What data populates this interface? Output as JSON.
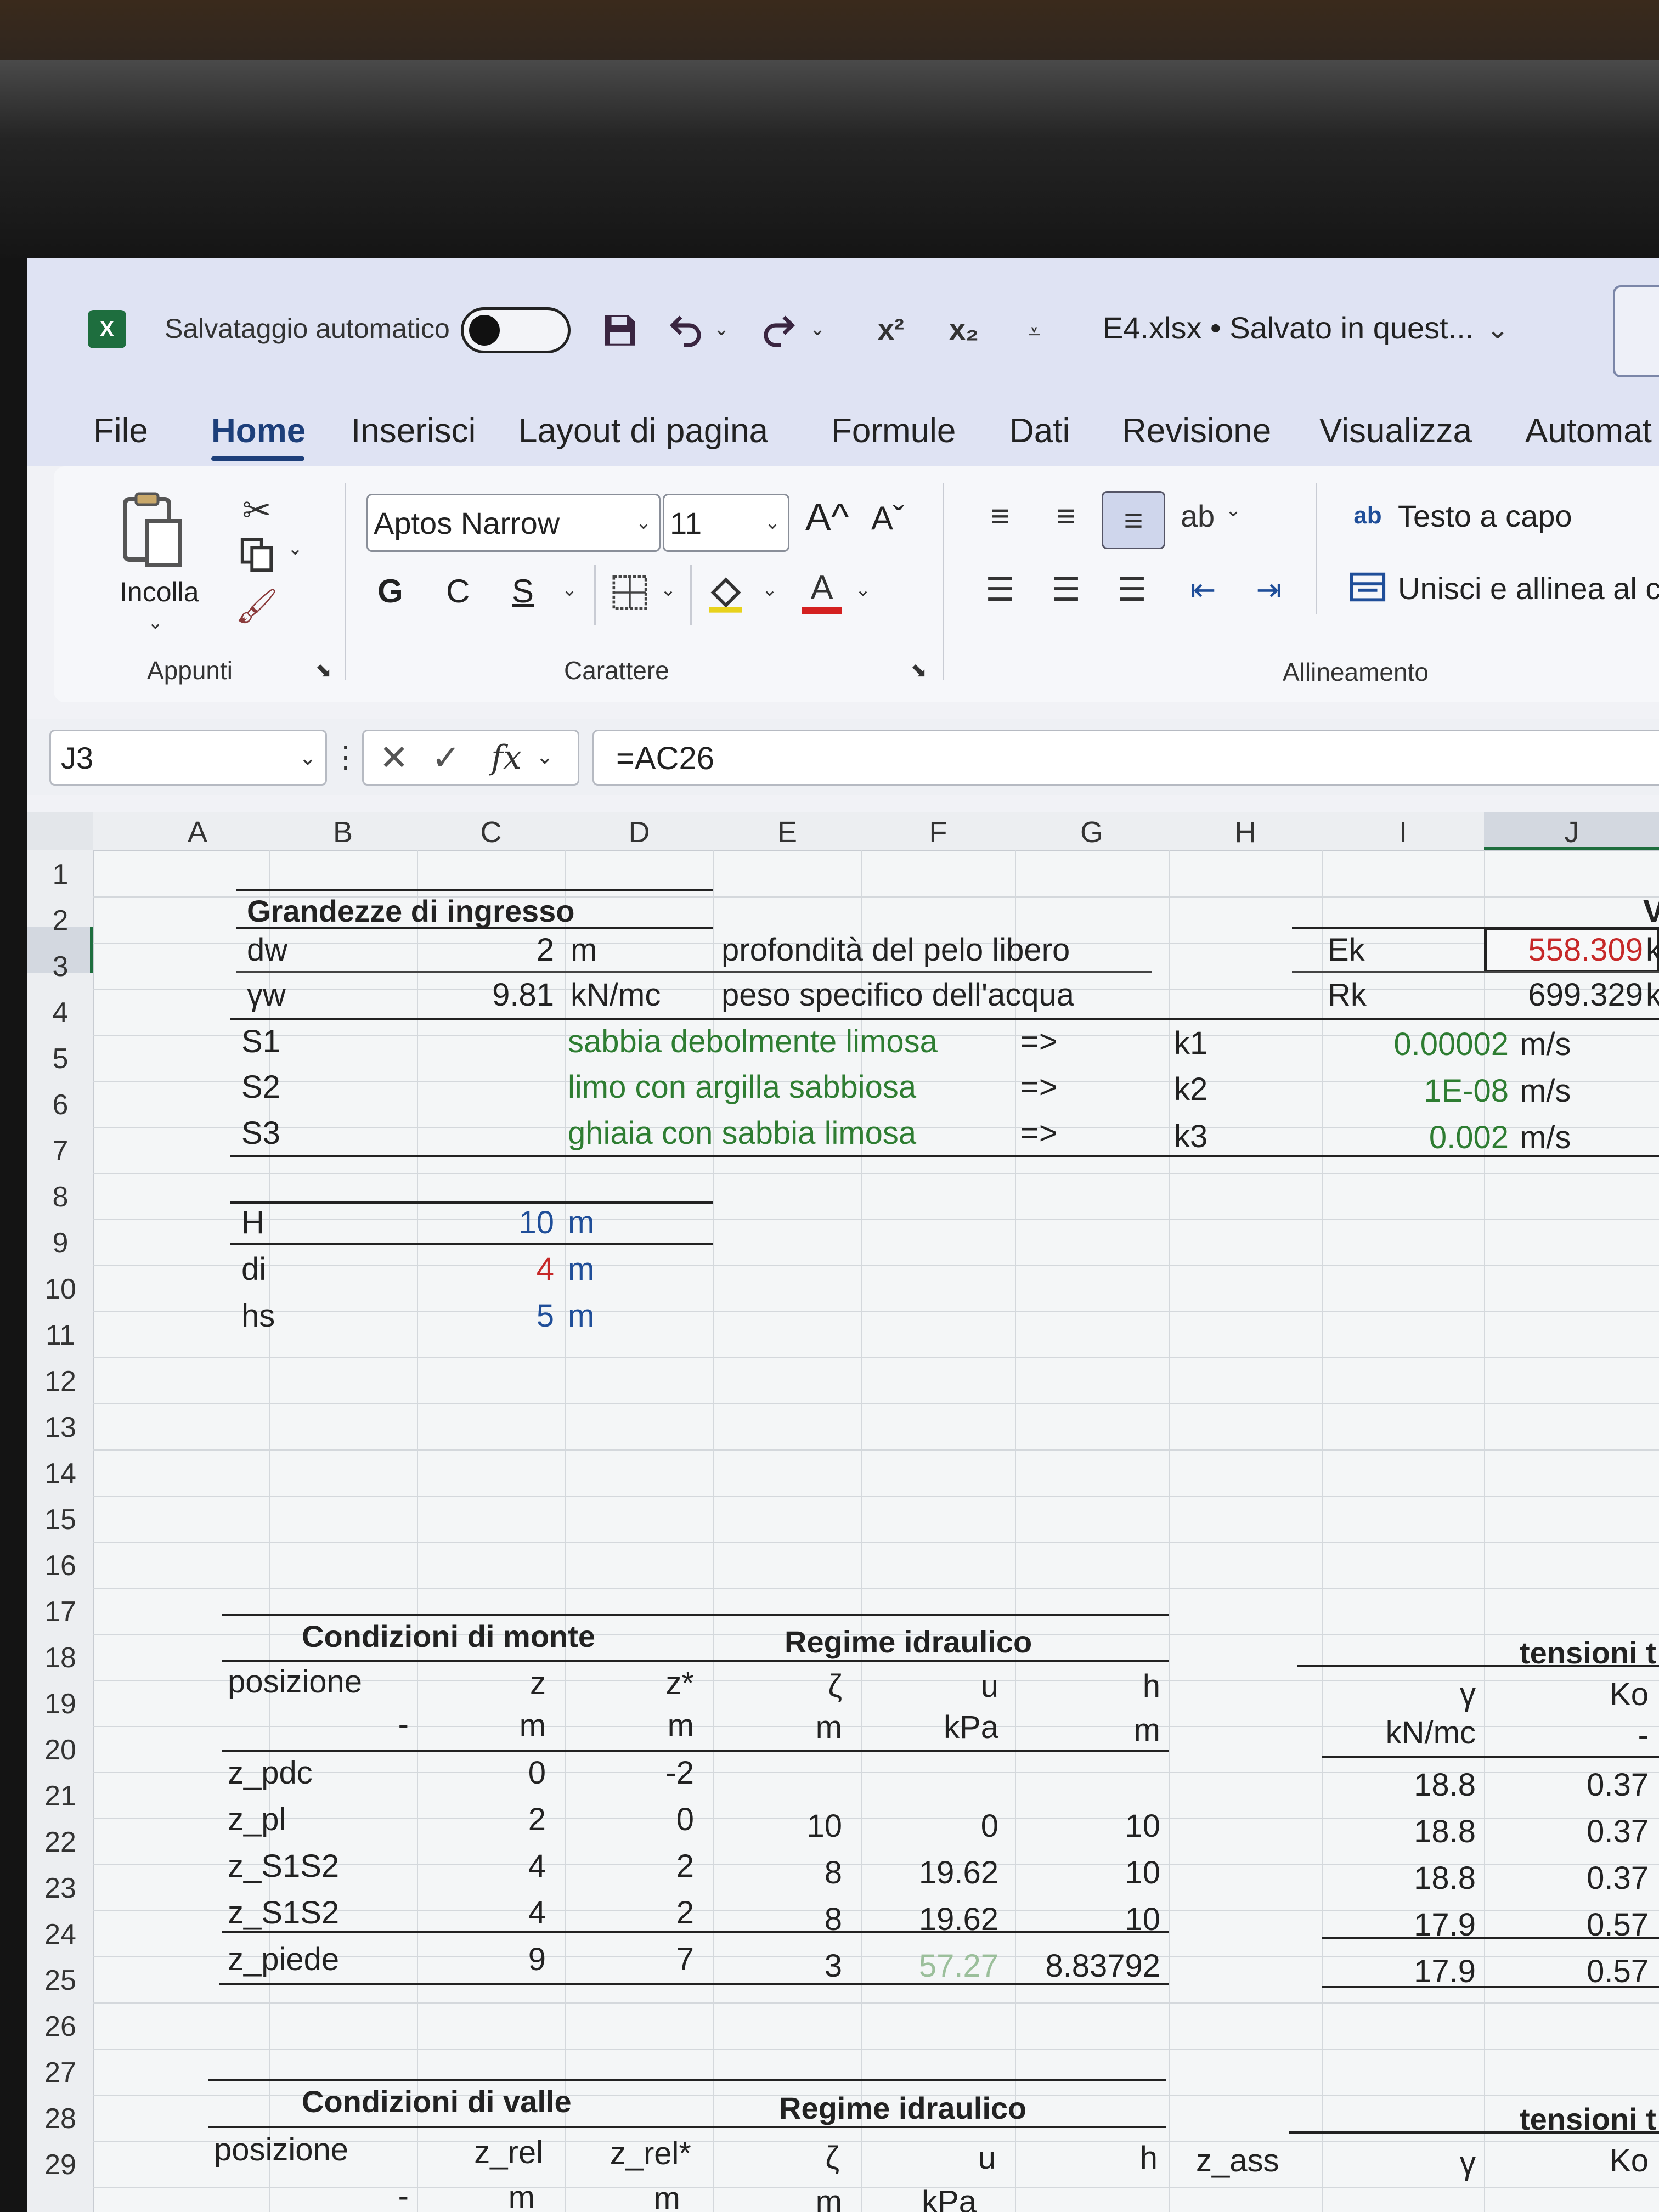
{
  "titlebar": {
    "app_icon": "excel-icon",
    "autosave_label": "Salvataggio automatico",
    "file_title": "E4.xlsx • Salvato in quest...",
    "superscript_label": "x²",
    "subscript_label": "x₂"
  },
  "tabs": [
    "File",
    "Home",
    "Inserisci",
    "Layout di pagina",
    "Formule",
    "Dati",
    "Revisione",
    "Visualizza",
    "Automat"
  ],
  "active_tab": "Home",
  "ribbon": {
    "paste_label": "Incolla",
    "clipboard_group": "Appunti",
    "font_name": "Aptos Narrow",
    "font_size": "11",
    "font_group": "Carattere",
    "bold": "G",
    "italic": "C",
    "underline": "S",
    "grow_font": "A^",
    "shrink_font": "Aˇ",
    "font_color_letter": "A",
    "wrap_text": "Testo a capo",
    "merge_center": "Unisci e allinea al cen",
    "alignment_group": "Allineamento"
  },
  "formula_bar": {
    "name_box": "J3",
    "formula": "=AC26"
  },
  "columns": [
    "A",
    "B",
    "C",
    "D",
    "E",
    "F",
    "G",
    "H",
    "I",
    "J"
  ],
  "rows": [
    "1",
    "2",
    "3",
    "4",
    "5",
    "6",
    "7",
    "8",
    "9",
    "10",
    "11",
    "12",
    "13",
    "14",
    "15",
    "16",
    "17",
    "18",
    "19",
    "20",
    "21",
    "22",
    "23",
    "24",
    "25",
    "26",
    "27",
    "28",
    "29"
  ],
  "sheet": {
    "title_input": "Grandezze di ingresso",
    "dw_label": "dw",
    "dw_value": "2",
    "dw_unit": "m",
    "dw_desc": "profondità del pelo libero",
    "gw_label": "γw",
    "gw_value": "9.81",
    "gw_unit": "kN/mc",
    "gw_desc": "peso specifico dell'acqua",
    "ek_label": "Ek",
    "ek_value": "558.309",
    "ek_unit": "k",
    "rk_label": "Rk",
    "rk_value": "699.329",
    "rk_unit": "k",
    "j2_partial": "V",
    "layers": [
      {
        "code": "S1",
        "desc": "sabbia debolmente limosa",
        "arrow": "=>",
        "k": "k1",
        "value": "0.00002",
        "unit": "m/s"
      },
      {
        "code": "S2",
        "desc": "limo con argilla sabbiosa",
        "arrow": "=>",
        "k": "k2",
        "value": "1E-08",
        "unit": "m/s"
      },
      {
        "code": "S3",
        "desc": "ghiaia con sabbia limosa",
        "arrow": "=>",
        "k": "k3",
        "value": "0.002",
        "unit": "m/s"
      }
    ],
    "edge_marks": [
      "=",
      "=",
      "=",
      "=",
      "=",
      "="
    ],
    "geometry": [
      {
        "label": "H",
        "value": "10",
        "unit": "m"
      },
      {
        "label": "di",
        "value": "4",
        "unit": "m"
      },
      {
        "label": "hs",
        "value": "5",
        "unit": "m"
      }
    ],
    "upstream_title": "Condizioni di monte",
    "hydraulic_title": "Regime idraulico",
    "stress_title": "tensioni t",
    "upstream_headers": [
      "posizione",
      "z",
      "z*",
      "ζ",
      "u",
      "h",
      "γ",
      "Ko"
    ],
    "upstream_units": [
      "-",
      "m",
      "m",
      "m",
      "kPa",
      "m",
      "kN/mc",
      "-"
    ],
    "upstream_rows": [
      {
        "pos": "z_pdc",
        "z": "0",
        "zs": "-2",
        "zeta": "",
        "u": "",
        "h": "",
        "gamma": "18.8",
        "ko": "0.37"
      },
      {
        "pos": "z_pl",
        "z": "2",
        "zs": "0",
        "zeta": "10",
        "u": "0",
        "h": "10",
        "gamma": "18.8",
        "ko": "0.37"
      },
      {
        "pos": "z_S1S2",
        "z": "4",
        "zs": "2",
        "zeta": "8",
        "u": "19.62",
        "h": "10",
        "gamma": "18.8",
        "ko": "0.37"
      },
      {
        "pos": "z_S1S2",
        "z": "4",
        "zs": "2",
        "zeta": "8",
        "u": "19.62",
        "h": "10",
        "gamma": "17.9",
        "ko": "0.57"
      },
      {
        "pos": "z_piede",
        "z": "9",
        "zs": "7",
        "zeta": "3",
        "u": "57.27",
        "h": "8.83792",
        "gamma": "17.9",
        "ko": "0.57"
      }
    ],
    "downstream_title": "Condizioni di valle",
    "downstream_hydraulic_title": "Regime idraulico",
    "downstream_stress_title": "tensioni t",
    "downstream_headers": [
      "posizione",
      "z_rel",
      "z_rel*",
      "ζ",
      "u",
      "h",
      "z_ass",
      "γ",
      "Ko"
    ],
    "downstream_units": [
      "-",
      "m",
      "m",
      "m",
      "kPa"
    ]
  },
  "colors": {
    "accent": "#1d3f7a",
    "green_text": "#2e7d32",
    "red_text": "#c62828",
    "title_bg": "#dfe3f3"
  }
}
